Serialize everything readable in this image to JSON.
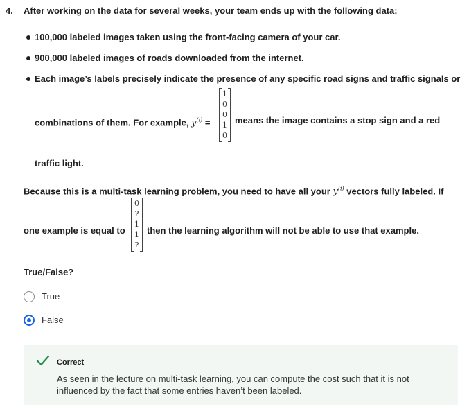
{
  "question": {
    "number": "4.",
    "text": "After working on the data for several weeks, your team ends up with the following data:",
    "bullets": [
      "100,000 labeled images taken using the front-facing camera of your car.",
      "900,000 labeled images of roads downloaded from the internet."
    ],
    "bullet3": {
      "line1": "Each image’s labels precisely indicate the presence of any specific road signs and traffic signals or",
      "pre": "combinations of them. For example, ",
      "math_y": "y",
      "math_sup": "(i)",
      "eq": " = ",
      "vector": [
        "1",
        "0",
        "0",
        "1",
        "0"
      ],
      "post": "means the image contains a stop sign and a red",
      "line3": "traffic light."
    },
    "para": {
      "line1_pre": "Because this is a multi-task learning problem, you need to have all your ",
      "math_y": "y",
      "math_sup": "(i)",
      "line1_post": " vectors fully labeled. If",
      "line2_pre": "one example is equal to ",
      "vector": [
        "0",
        "?",
        "1",
        "1",
        "?"
      ],
      "line2_post": "then the learning algorithm will not be able to use that example."
    },
    "prompt": "True/False?"
  },
  "options": [
    {
      "label": "True",
      "selected": false
    },
    {
      "label": "False",
      "selected": true
    }
  ],
  "feedback": {
    "status": "Correct",
    "text": "As seen in the lecture on multi-task learning, you can compute the cost such that it is not influenced by the fact that some entries haven’t been labeled.",
    "color": "#1e8c45"
  },
  "colors": {
    "accent": "#1a64e0",
    "success": "#1e8c45",
    "feedback_bg": "#f2f7f3"
  }
}
